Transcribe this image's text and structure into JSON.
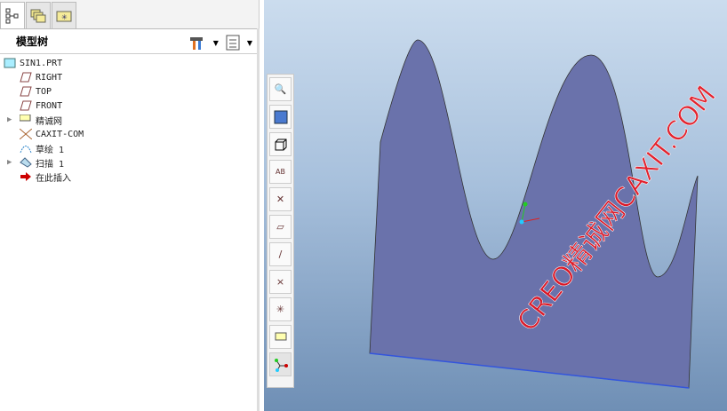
{
  "panel": {
    "title": "模型树"
  },
  "tabs": [
    "model-tree",
    "folder-browser",
    "favorites"
  ],
  "tree": [
    {
      "label": "SIN1.PRT",
      "icon": "part-icon",
      "indent": 0,
      "expand": false
    },
    {
      "label": "RIGHT",
      "icon": "datum-plane-icon",
      "indent": 1,
      "expand": false
    },
    {
      "label": "TOP",
      "icon": "datum-plane-icon",
      "indent": 1,
      "expand": false
    },
    {
      "label": "FRONT",
      "icon": "datum-plane-icon",
      "indent": 1,
      "expand": false
    },
    {
      "label": "精诚网",
      "icon": "layer-icon",
      "indent": 1,
      "expand": true
    },
    {
      "label": "CAXIT-COM",
      "icon": "csys-icon",
      "indent": 1,
      "expand": false
    },
    {
      "label": "草绘 1",
      "icon": "sketch-icon",
      "indent": 1,
      "expand": false
    },
    {
      "label": "扫描 1",
      "icon": "sweep-icon",
      "indent": 1,
      "expand": true
    },
    {
      "label": "在此插入",
      "icon": "insert-here-icon",
      "indent": 1,
      "expand": false
    }
  ],
  "watermark": "CREO精诚网CAXIT.COM",
  "colors": {
    "surface": "#6a72ab",
    "watermark": "#e8101a"
  }
}
